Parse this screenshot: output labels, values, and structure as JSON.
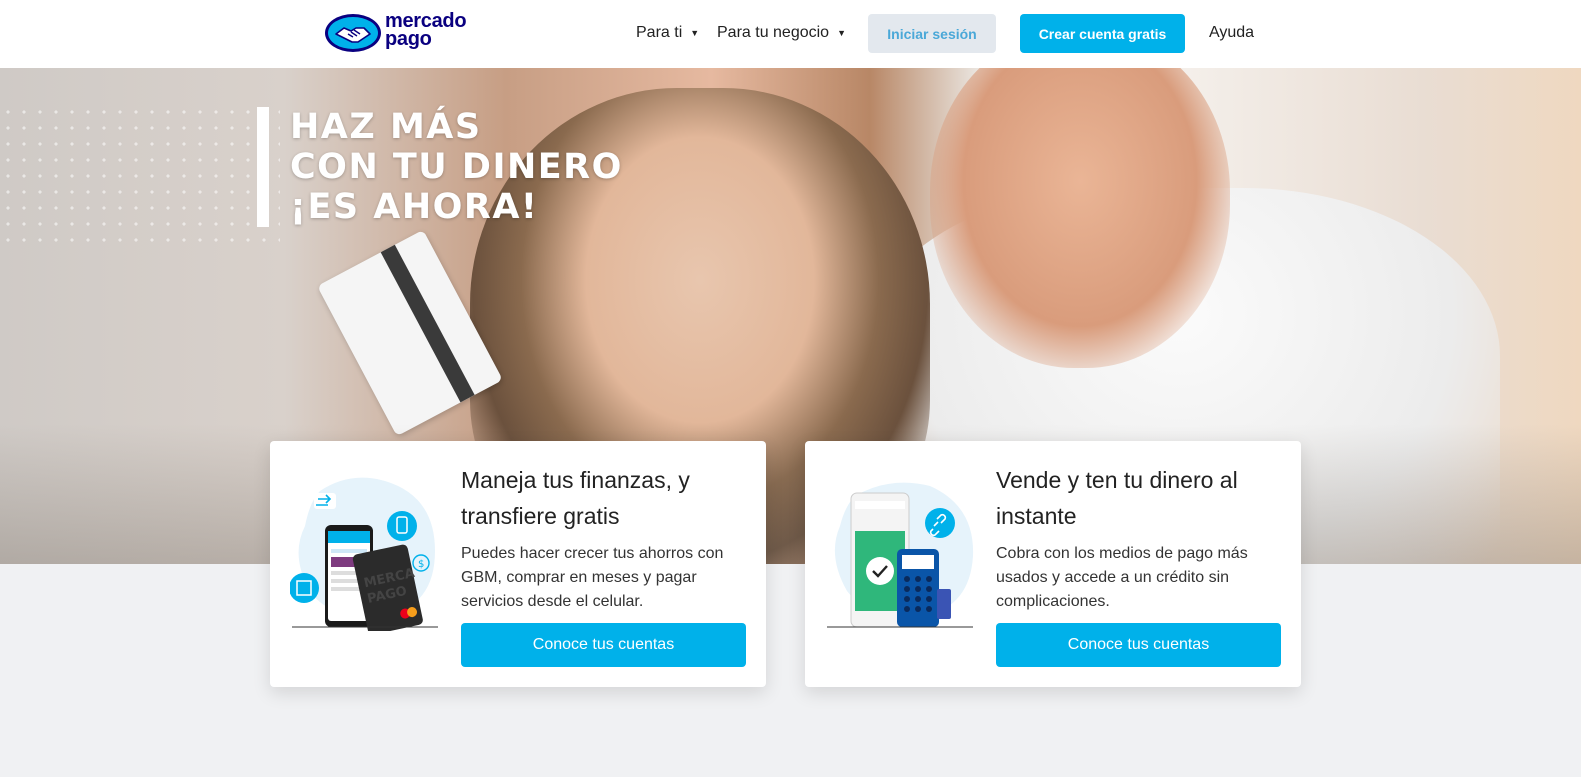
{
  "header": {
    "logo": {
      "line1": "mercado",
      "line2": "pago"
    },
    "nav": [
      {
        "label": "Para ti",
        "has_dropdown": true
      },
      {
        "label": "Para tu negocio",
        "has_dropdown": true
      }
    ],
    "login_label": "Iniciar sesión",
    "create_label": "Crear cuenta gratis",
    "help_label": "Ayuda"
  },
  "hero": {
    "title_lines": [
      "HAZ MÁS",
      "CON TU DINERO",
      "¡ES AHORA!"
    ]
  },
  "cards": [
    {
      "title": "Maneja tus finanzas, y transfiere gratis",
      "body": "Puedes hacer crecer tus ahorros con GBM, comprar en meses y pagar servicios desde el celular.",
      "cta": "Conoce tus cuentas"
    },
    {
      "title": "Vende y ten tu dinero al instante",
      "body": "Cobra con los medios de pago más usados y accede a un crédito sin complicaciones.",
      "cta": "Conoce tus cuentas"
    }
  ],
  "colors": {
    "brand_blue": "#00b1ea",
    "brand_navy": "#0a0080",
    "login_bg": "#e3e8ee"
  }
}
